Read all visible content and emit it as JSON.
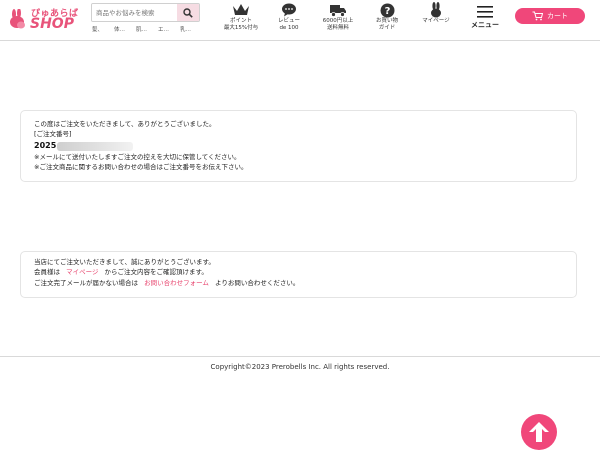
{
  "header": {
    "logo": {
      "brand_top": "ぴゅあらば",
      "brand_bottom": "SHOP"
    },
    "search": {
      "placeholder": "商品やお悩みを検索"
    },
    "subnav": [
      "髪、",
      "体…",
      "肌…",
      "エ…",
      "乳…"
    ],
    "nav": [
      {
        "icon": "crown-icon",
        "line1": "ポイント",
        "line2": "最大15%付与"
      },
      {
        "icon": "speech-bubble-icon",
        "line1": "レビュー",
        "line2": "de 100"
      },
      {
        "icon": "truck-icon",
        "line1": "6000円以上",
        "line2": "送料無料"
      },
      {
        "icon": "question-icon",
        "line1": "お買い物",
        "line2": "ガイド"
      },
      {
        "icon": "rabbit-icon",
        "line1": "マイページ",
        "line2": ""
      },
      {
        "icon": "hamburger-icon",
        "line1": "メニュー",
        "line2": ""
      }
    ],
    "cart_label": "カート"
  },
  "order_card": {
    "thanks": "この度はご注文をいただきまして、ありがとうございました。",
    "order_number_label": "[ご注文番号]",
    "order_number_prefix": "2025",
    "note1": "※メールにて送付いたしますご注文の控えを大切に保管してください。",
    "note2": "※ご注文商品に関するお問い合わせの場合はご注文番号をお伝え下さい。"
  },
  "info_card": {
    "line1": "当店にてご注文いただきまして、誠にありがとうございます。",
    "line2_before": "会員様は",
    "line2_link": "マイページ",
    "line2_after": "からご注文内容をご確認頂けます。",
    "line3_before": "ご注文完了メールが届かない場合は",
    "line3_link": "お問い合わせフォーム",
    "line3_after": "よりお問い合わせください。"
  },
  "footer": {
    "copyright": "Copyright©2023 Prerobells Inc. All rights reserved."
  },
  "colors": {
    "accent": "#f0477a",
    "link": "#e8466f"
  }
}
